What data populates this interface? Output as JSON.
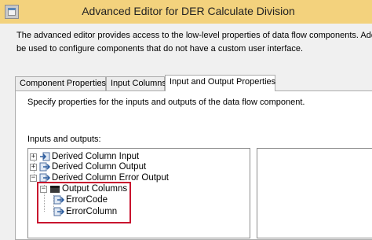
{
  "window": {
    "title": "Advanced Editor for DER Calculate Division"
  },
  "description": {
    "line1": "The advanced editor provides access to the low-level properties of data flow components. Additi",
    "line2": "be used to configure components that do not have a custom user interface."
  },
  "tabs": [
    {
      "label": "Component Properties",
      "active": false
    },
    {
      "label": "Input Columns",
      "active": false
    },
    {
      "label": "Input and Output Properties",
      "active": true
    }
  ],
  "panel": {
    "instruction": "Specify properties for the inputs and outputs of the data flow component.",
    "tree_label": "Inputs and outputs:"
  },
  "tree": {
    "nodes": [
      {
        "label": "Derived Column Input",
        "toggle": "+",
        "icon": "input-icon"
      },
      {
        "label": "Derived Column Output",
        "toggle": "+",
        "icon": "output-icon"
      },
      {
        "label": "Derived Column Error Output",
        "toggle": "−",
        "icon": "error-output-icon"
      },
      {
        "label": "Output Columns",
        "toggle": "−",
        "icon": "folder-icon"
      },
      {
        "label": "ErrorCode",
        "toggle": "",
        "icon": "column-icon"
      },
      {
        "label": "ErrorColumn",
        "toggle": "",
        "icon": "column-icon"
      }
    ]
  },
  "colors": {
    "titlebar": "#f3d27d",
    "highlight_border": "#c8102e"
  }
}
